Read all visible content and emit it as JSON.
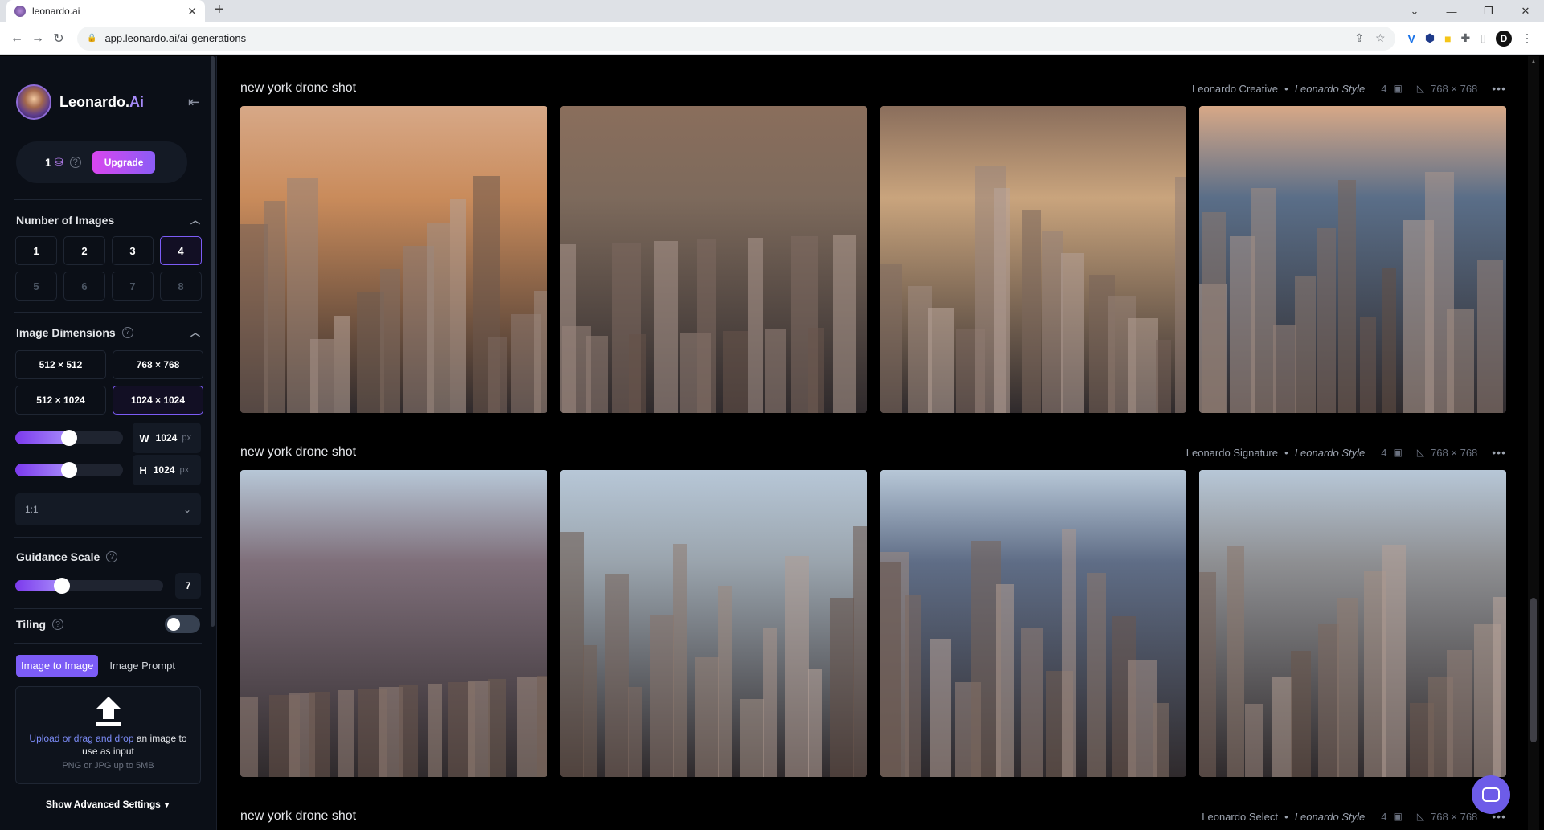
{
  "browser": {
    "tab_title": "leonardo.ai",
    "url": "app.leonardo.ai/ai-generations",
    "profile_initial": "D"
  },
  "sidebar": {
    "logo_text": "Leonardo.",
    "logo_ai": "Ai",
    "credits": "1",
    "upgrade_label": "Upgrade",
    "number_of_images": {
      "title": "Number of Images",
      "options": [
        "1",
        "2",
        "3",
        "4",
        "5",
        "6",
        "7",
        "8"
      ],
      "selected": "4"
    },
    "image_dimensions": {
      "title": "Image Dimensions",
      "options": [
        "512 × 512",
        "768 × 768",
        "512 × 1024",
        "1024 × 1024"
      ],
      "selected": "1024 × 1024",
      "width_label": "W",
      "width_value": "1024",
      "height_label": "H",
      "height_value": "1024",
      "unit": "px",
      "width_slider_level": 0.42,
      "height_slider_level": 0.42,
      "aspect_ratio": "1:1"
    },
    "guidance_scale": {
      "title": "Guidance Scale",
      "value": "7",
      "slider_level": 0.3
    },
    "tiling": {
      "title": "Tiling",
      "enabled": false
    },
    "image_tabs": [
      "Image to Image",
      "Image Prompt"
    ],
    "upload": {
      "link_text": "Upload or drag and drop",
      "text": " an image to use as input",
      "formats": "PNG or JPG up to 5MB"
    },
    "advanced_label": "Show Advanced Settings"
  },
  "generations": [
    {
      "prompt": "new york drone shot",
      "model": "Leonardo Creative",
      "style": "Leonardo Style",
      "count": "4",
      "dimensions": "768 × 768",
      "palette": [
        "#c98b5b",
        "#7d6a5c",
        "#c9a47d",
        "#5a6e88"
      ]
    },
    {
      "prompt": "new york drone shot",
      "model": "Leonardo Signature",
      "style": "Leonardo Style",
      "count": "4",
      "dimensions": "768 × 768",
      "palette": [
        "#7f6f7a",
        "#9aa4ad",
        "#5f6d86",
        "#8e8f92"
      ]
    },
    {
      "prompt": "new york drone shot",
      "model": "Leonardo Select",
      "style": "Leonardo Style",
      "count": "4",
      "dimensions": "768 × 768",
      "palette": []
    }
  ]
}
